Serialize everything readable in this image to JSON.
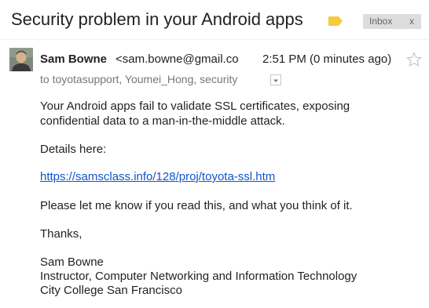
{
  "email": {
    "subject": "Security problem in your Android apps",
    "label_chip": {
      "text": "Inbox",
      "close": "x"
    },
    "sender": {
      "name": "Sam Bowne",
      "email": "<sam.bowne@gmail.com>"
    },
    "time": "2:51 PM (0 minutes ago)",
    "to": "to toyotasupport, Youmei_Hong, security",
    "body": {
      "line1": "Your Android apps fail to validate SSL certificates, exposing",
      "line2": "confidential data to a man-in-the-middle attack.",
      "details": "Details here:",
      "link": "https://samsclass.info/128/proj/toyota-ssl.htm",
      "request": "Please let me know if you read this, and what you think of it.",
      "thanks": "Thanks,",
      "sig_name": "Sam Bowne",
      "sig_title": "Instructor, Computer Networking and Information Technology",
      "sig_org": "City College San Francisco"
    }
  },
  "colors": {
    "important_marker": "#f5cc3c",
    "link": "#1155cc",
    "chip_bg": "#dddddd"
  },
  "icons": {
    "label": "important-marker-icon",
    "star": "star-icon",
    "toggle": "chevron-down-icon"
  }
}
